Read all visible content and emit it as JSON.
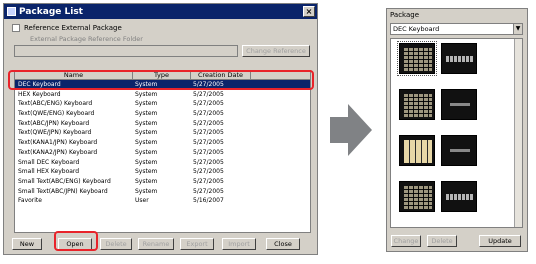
{
  "package_list": {
    "title": "Package List",
    "close_glyph": "×",
    "reference_checkbox_label": "Reference External Package",
    "folder_label": "External Package Reference Folder",
    "change_reference_button": "Change Reference",
    "columns": [
      "Name",
      "Type",
      "Creation Date"
    ],
    "rows": [
      {
        "name": "DEC Keyboard",
        "type": "System",
        "date": "5/27/2005"
      },
      {
        "name": "HEX Keyboard",
        "type": "System",
        "date": "5/27/2005"
      },
      {
        "name": "Text(ABC/ENG) Keyboard",
        "type": "System",
        "date": "5/27/2005"
      },
      {
        "name": "Text(QWE/ENG) Keyboard",
        "type": "System",
        "date": "5/27/2005"
      },
      {
        "name": "Text(ABC/JPN) Keyboard",
        "type": "System",
        "date": "5/27/2005"
      },
      {
        "name": "Text(QWE/JPN) Keyboard",
        "type": "System",
        "date": "5/27/2005"
      },
      {
        "name": "Text(KANA1/JPN) Keyboard",
        "type": "System",
        "date": "5/27/2005"
      },
      {
        "name": "Text(KANA2/JPN) Keyboard",
        "type": "System",
        "date": "5/27/2005"
      },
      {
        "name": "Small DEC Keyboard",
        "type": "System",
        "date": "5/27/2005"
      },
      {
        "name": "Small HEX Keyboard",
        "type": "System",
        "date": "5/27/2005"
      },
      {
        "name": "Small Text(ABC/ENG) Keyboard",
        "type": "System",
        "date": "5/27/2005"
      },
      {
        "name": "Small Text(ABC/JPN) Keyboard",
        "type": "System",
        "date": "5/27/2005"
      },
      {
        "name": "Favorite",
        "type": "User",
        "date": "5/16/2007"
      }
    ],
    "buttons": {
      "new": "New",
      "open": "Open",
      "delete": "Delete",
      "rename": "Rename",
      "export": "Export",
      "import": "Import",
      "close": "Close"
    }
  },
  "package_window": {
    "title": "Package",
    "selected_package": "DEC Keyboard",
    "buttons": {
      "change": "Change",
      "delete": "Delete",
      "update": "Update"
    }
  },
  "colors": {
    "selection": "#0a246a",
    "highlight": "#e8232a",
    "arrow": "#808285"
  }
}
